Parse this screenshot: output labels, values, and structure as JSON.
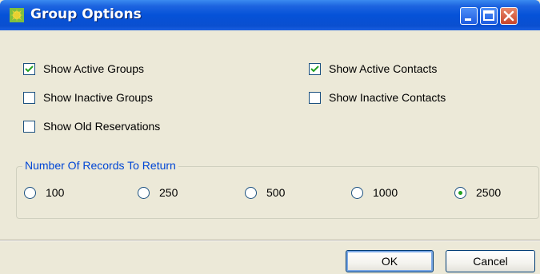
{
  "window": {
    "title": "Group Options",
    "icon": "group-options-app-icon",
    "controls": [
      "minimize-icon",
      "maximize-icon",
      "close-icon"
    ]
  },
  "options": {
    "show_active_groups": {
      "label": "Show Active Groups",
      "checked": true
    },
    "show_inactive_groups": {
      "label": "Show Inactive Groups",
      "checked": false
    },
    "show_old_reservations": {
      "label": "Show Old Reservations",
      "checked": false
    },
    "show_active_contacts": {
      "label": "Show Active Contacts",
      "checked": true
    },
    "show_inactive_contacts": {
      "label": "Show Inactive Contacts",
      "checked": false
    }
  },
  "records": {
    "legend": "Number Of Records To Return",
    "choices": [
      "100",
      "250",
      "500",
      "1000",
      "2500"
    ],
    "selected": "2500"
  },
  "buttons": {
    "ok": "OK",
    "cancel": "Cancel"
  },
  "colors": {
    "titlebar": "#0552d8",
    "dialog_bg": "#ece9d8",
    "legend_text": "#0046d5",
    "check_mark": "#21a121"
  }
}
